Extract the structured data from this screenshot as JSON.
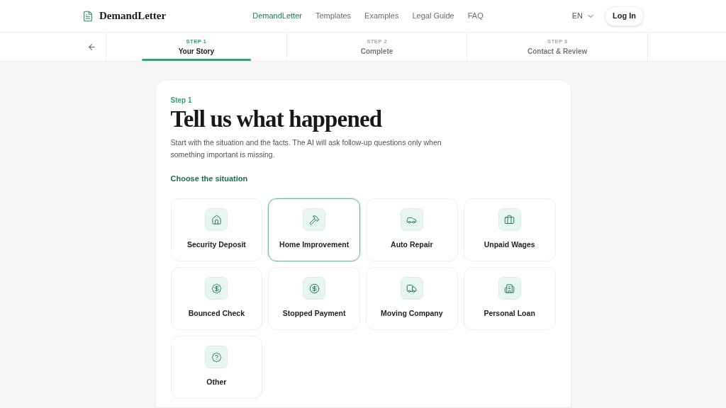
{
  "header": {
    "brand": "DemandLetter",
    "nav": [
      {
        "label": "DemandLetter",
        "selected": true
      },
      {
        "label": "Templates",
        "selected": false
      },
      {
        "label": "Examples",
        "selected": false
      },
      {
        "label": "Legal Guide",
        "selected": false
      },
      {
        "label": "FAQ",
        "selected": false
      }
    ],
    "language": "EN",
    "login": "Log In"
  },
  "steps": [
    {
      "number": "STEP 1",
      "label": "Your Story",
      "selected": true
    },
    {
      "number": "STEP 2",
      "label": "Complete",
      "selected": false
    },
    {
      "number": "STEP 3",
      "label": "Contact & Review",
      "selected": false
    }
  ],
  "card": {
    "eyebrow": "Step 1",
    "title": "Tell us what happened",
    "description": "Start with the situation and the facts. The AI will ask follow-up questions only when something important is missing.",
    "section_label": "Choose the situation",
    "situations": [
      {
        "label": "Security Deposit",
        "selected": false
      },
      {
        "label": "Home Improvement",
        "selected": true
      },
      {
        "label": "Auto Repair",
        "selected": false
      },
      {
        "label": "Unpaid Wages",
        "selected": false
      },
      {
        "label": "Bounced Check",
        "selected": false
      },
      {
        "label": "Stopped Payment",
        "selected": false
      },
      {
        "label": "Moving Company",
        "selected": false
      },
      {
        "label": "Personal Loan",
        "selected": false
      },
      {
        "label": "Other",
        "selected": false
      }
    ]
  }
}
